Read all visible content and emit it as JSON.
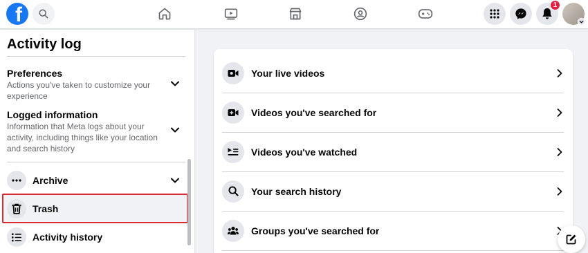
{
  "brand": {
    "logo_letter": "f",
    "color": "#1877f2"
  },
  "topbar": {
    "nav_icons": [
      "home-icon",
      "video-icon",
      "marketplace-icon",
      "groups-icon",
      "gaming-icon"
    ],
    "right_icons": [
      "menu-grid-icon",
      "messenger-icon",
      "notifications-icon"
    ],
    "notification_count": "1"
  },
  "sidebar": {
    "title": "Activity log",
    "sections": [
      {
        "title": "Preferences",
        "description": "Actions you've taken to customize your experience"
      },
      {
        "title": "Logged information",
        "description": "Information that Meta logs about your activity, including things like your location and search history"
      }
    ],
    "nav": [
      {
        "label": "Archive",
        "icon": "more-dots-icon"
      },
      {
        "label": "Trash",
        "icon": "trash-icon"
      },
      {
        "label": "Activity history",
        "icon": "list-icon"
      }
    ]
  },
  "main": {
    "items": [
      {
        "label": "Your live videos",
        "icon": "live-video-icon"
      },
      {
        "label": "Videos you've searched for",
        "icon": "video-camera-plus-icon"
      },
      {
        "label": "Videos you've watched",
        "icon": "playlist-icon"
      },
      {
        "label": "Your search history",
        "icon": "search-icon"
      },
      {
        "label": "Groups you've searched for",
        "icon": "groups-icon"
      }
    ]
  },
  "colors": {
    "highlight_border": "#d82a2f",
    "badge": "#e41e3f",
    "text_secondary": "#65676b"
  }
}
